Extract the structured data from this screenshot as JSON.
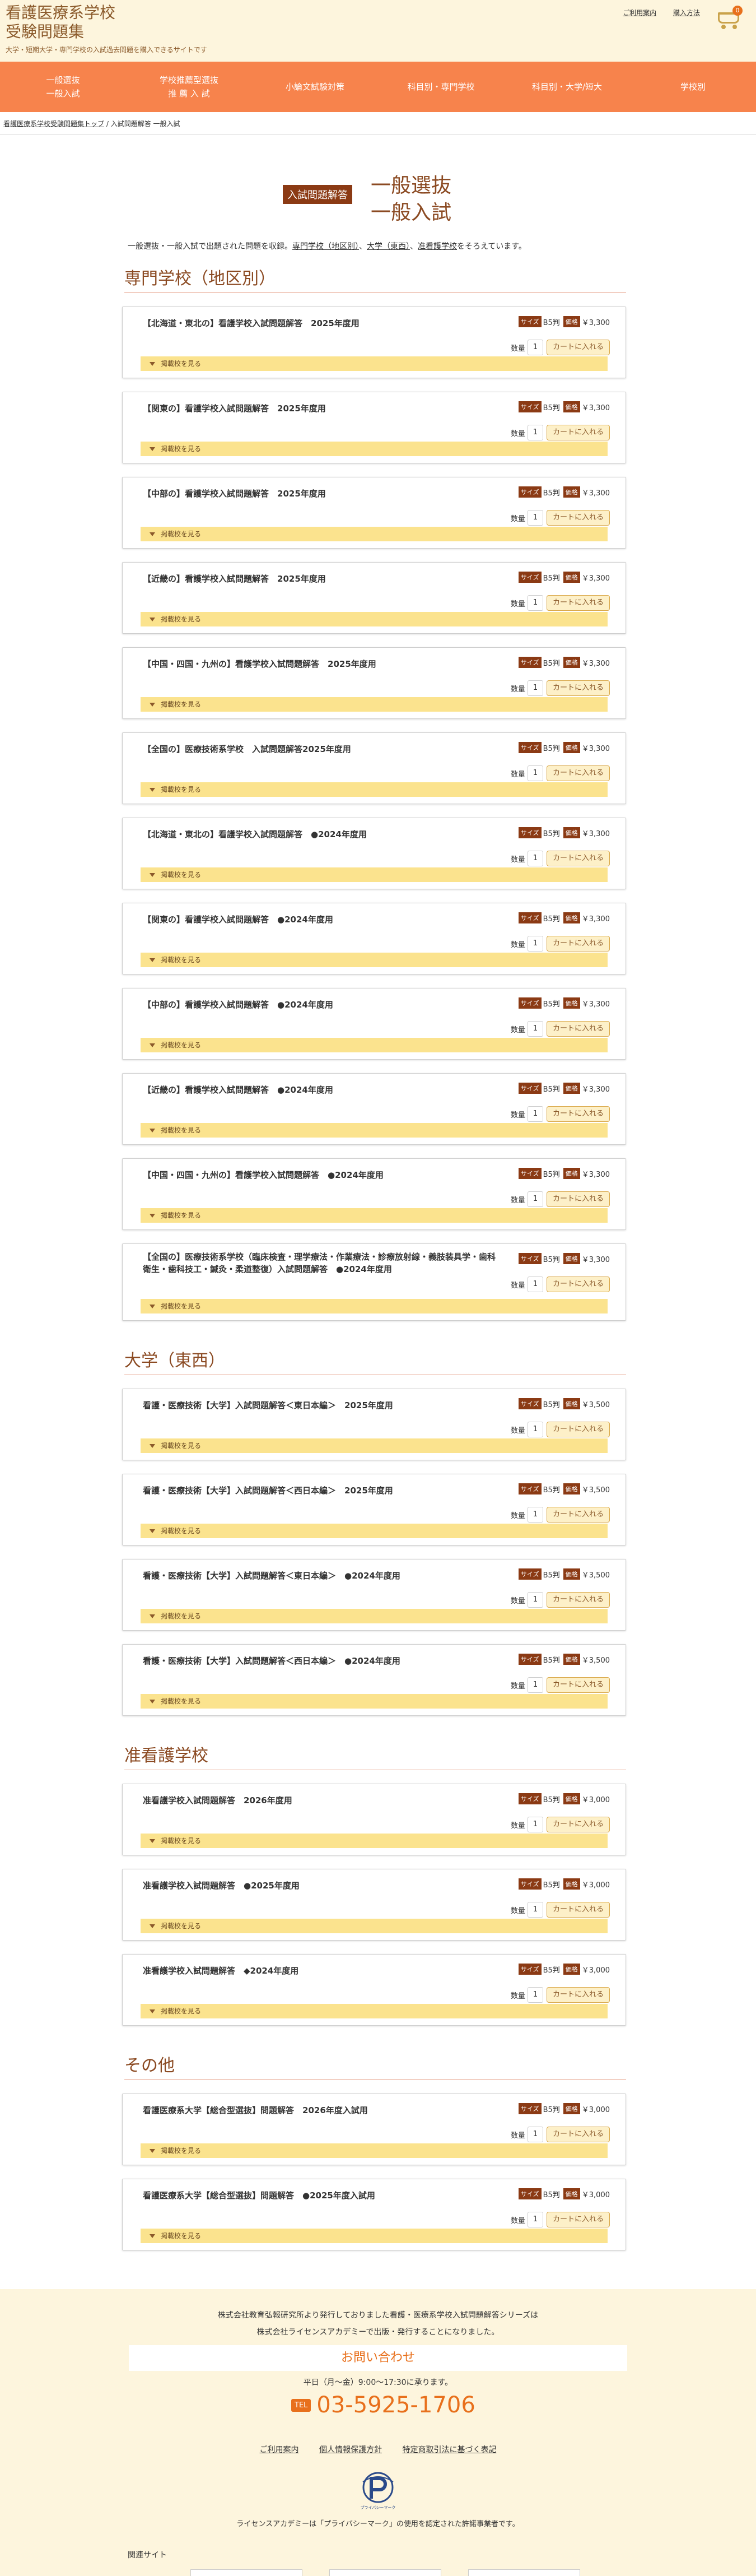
{
  "header": {
    "title_line1": "看護医療系学校",
    "title_line2": "受験問題集",
    "subtitle": "大学・短期大学・専門学校の入試過去問題を購入できるサイトです",
    "links": [
      "ご利用案内",
      "購入方法"
    ],
    "cart_count": "0"
  },
  "nav": [
    {
      "line1": "一般選抜",
      "line2": "一般入試"
    },
    {
      "line1": "学校推薦型選抜",
      "line2": "推 薦 入 試"
    },
    {
      "line1": "小論文試験対策",
      "line2": ""
    },
    {
      "line1": "科目別・専門学校",
      "line2": ""
    },
    {
      "line1": "科目別・大学/短大",
      "line2": ""
    },
    {
      "line1": "学校別",
      "line2": ""
    }
  ],
  "breadcrumb": {
    "home": "看護医療系学校受験問題集トップ",
    "sep": "/",
    "current": "入試問題解答 一般入試"
  },
  "page_title": {
    "badge": "入試問題解答",
    "line1": "一般選抜",
    "line2": "一般入試"
  },
  "intro": {
    "prefix": "一般選抜・一般入試で出題された問題を収録。",
    "link1": "専門学校（地区別）",
    "sep1": "、",
    "link2": "大学（東西）",
    "sep2": "、",
    "link3": "准看護学校",
    "suffix": "をそろえています。"
  },
  "labels": {
    "size_tag": "サイズ",
    "price_tag": "価格",
    "qty": "数量",
    "cart_button": "カートに入れる",
    "schools": "掲載校を見る"
  },
  "sections": [
    {
      "heading": "専門学校（地区別）",
      "products": [
        {
          "title": "【北海道・東北の】看護学校入試問題解答　2025年度用",
          "size": "B5判",
          "price": "￥3,300",
          "qty": "1"
        },
        {
          "title": "【関東の】看護学校入試問題解答　2025年度用",
          "size": "B5判",
          "price": "￥3,300",
          "qty": "1"
        },
        {
          "title": "【中部の】看護学校入試問題解答　2025年度用",
          "size": "B5判",
          "price": "￥3,300",
          "qty": "1"
        },
        {
          "title": "【近畿の】看護学校入試問題解答　2025年度用",
          "size": "B5判",
          "price": "￥3,300",
          "qty": "1"
        },
        {
          "title": "【中国・四国・九州の】看護学校入試問題解答　2025年度用",
          "size": "B5判",
          "price": "￥3,300",
          "qty": "1"
        },
        {
          "title": "【全国の】医療技術系学校　入試問題解答2025年度用",
          "size": "B5判",
          "price": "￥3,300",
          "qty": "1"
        },
        {
          "title": "【北海道・東北の】看護学校入試問題解答　●2024年度用",
          "size": "B5判",
          "price": "￥3,300",
          "qty": "1"
        },
        {
          "title": "【関東の】看護学校入試問題解答　●2024年度用",
          "size": "B5判",
          "price": "￥3,300",
          "qty": "1"
        },
        {
          "title": "【中部の】看護学校入試問題解答　●2024年度用",
          "size": "B5判",
          "price": "￥3,300",
          "qty": "1"
        },
        {
          "title": "【近畿の】看護学校入試問題解答　●2024年度用",
          "size": "B5判",
          "price": "￥3,300",
          "qty": "1"
        },
        {
          "title": "【中国・四国・九州の】看護学校入試問題解答　●2024年度用",
          "size": "B5判",
          "price": "￥3,300",
          "qty": "1"
        },
        {
          "title": "【全国の】医療技術系学校（臨床検査・理学療法・作業療法・診療放射線・義肢装具学・歯科衛生・歯科技工・鍼灸・柔道整復）入試問題解答　●2024年度用",
          "size": "B5判",
          "price": "￥3,300",
          "qty": "1",
          "tall": true
        }
      ]
    },
    {
      "heading": "大学（東西）",
      "products": [
        {
          "title": "看護・医療技術【大学】入試問題解答＜東日本編＞　2025年度用",
          "size": "B5判",
          "price": "￥3,500",
          "qty": "1"
        },
        {
          "title": "看護・医療技術【大学】入試問題解答＜西日本編＞　2025年度用",
          "size": "B5判",
          "price": "￥3,500",
          "qty": "1"
        },
        {
          "title": "看護・医療技術【大学】入試問題解答＜東日本編＞　●2024年度用",
          "size": "B5判",
          "price": "￥3,500",
          "qty": "1"
        },
        {
          "title": "看護・医療技術【大学】入試問題解答＜西日本編＞　●2024年度用",
          "size": "B5判",
          "price": "￥3,500",
          "qty": "1"
        }
      ]
    },
    {
      "heading": "准看護学校",
      "products": [
        {
          "title": "准看護学校入試問題解答　2026年度用",
          "size": "B5判",
          "price": "￥3,000",
          "qty": "1"
        },
        {
          "title": "准看護学校入試問題解答　●2025年度用",
          "size": "B5判",
          "price": "￥3,000",
          "qty": "1"
        },
        {
          "title": "准看護学校入試問題解答　◆2024年度用",
          "size": "B5判",
          "price": "￥3,000",
          "qty": "1"
        }
      ]
    },
    {
      "heading": "その他",
      "products": [
        {
          "title": "看護医療系大学【総合型選抜】問題解答　2026年度入試用",
          "size": "B5判",
          "price": "￥3,000",
          "qty": "1"
        },
        {
          "title": "看護医療系大学【総合型選抜】問題解答　●2025年度入試用",
          "size": "B5判",
          "price": "￥3,000",
          "qty": "1"
        }
      ]
    }
  ],
  "footer": {
    "note_line1": "株式会社教育弘報研究所より発行しておりました看護・医療系学校入試問題解答シリーズは",
    "note_line2": "株式会社ライセンスアカデミーで出版・発行することになりました。",
    "contact_title": "お問い合わせ",
    "hours": "平日（月〜金）9:00〜17:30に承ります。",
    "tel_label": "TEL",
    "phone": "03-5925-1706",
    "links": [
      "ご利用案内",
      "個人情報保護方針",
      "特定商取引法に基づく表記"
    ],
    "privacy_mark_text": "プライバシーマーク",
    "privacy_caption": "ライセンスアカデミーは「プライバシーマーク」の使用を認定された許諾事業者です。",
    "related_heading": "関連サイト"
  },
  "colors": {
    "nav_bg": "#f7834c",
    "header_bg": "#fdf5dd",
    "accent_brown": "#8b3a14",
    "bar_yellow": "#fbe38e",
    "phone_orange": "#e8701c"
  }
}
